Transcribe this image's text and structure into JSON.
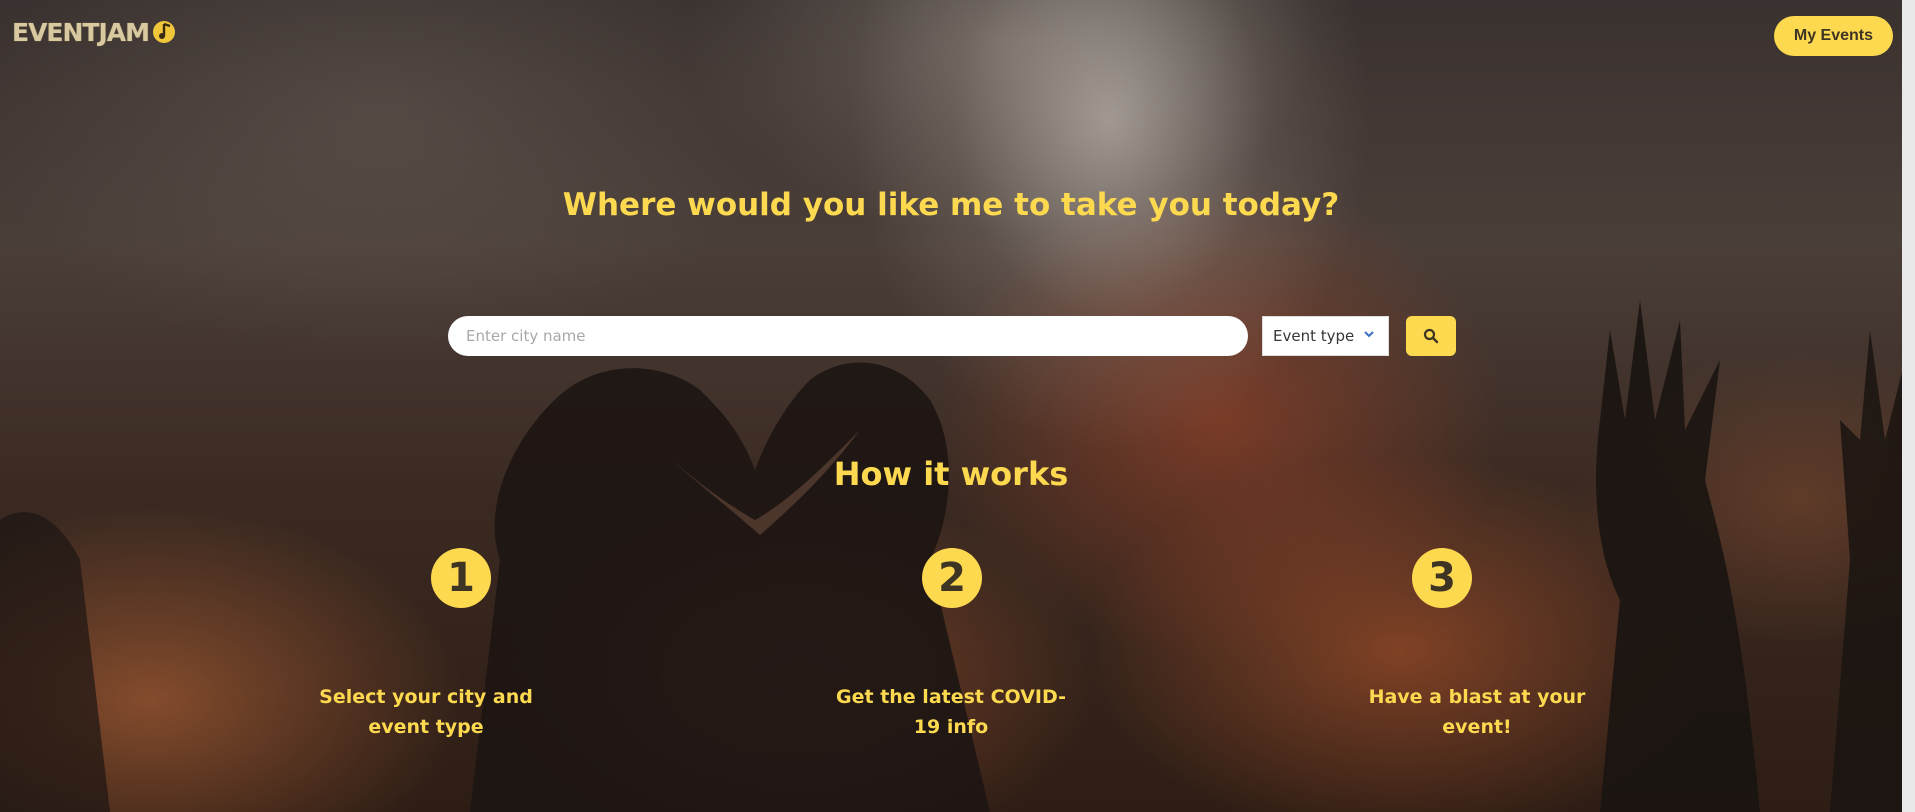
{
  "header": {
    "logo_text": "EVENTJAM",
    "my_events_label": "My Events"
  },
  "hero": {
    "headline": "Where would you like me to take you today?"
  },
  "search": {
    "placeholder": "Enter city name",
    "value": "",
    "event_type_label": "Event type"
  },
  "how_it_works": {
    "title": "How it works",
    "steps": [
      {
        "number": "1",
        "text": "Select your city and event type"
      },
      {
        "number": "2",
        "text": "Get the latest COVID-19 info"
      },
      {
        "number": "3",
        "text": "Have a blast at your event!"
      }
    ]
  },
  "colors": {
    "accent": "#fdd950",
    "button_text": "#3d3424",
    "chevron": "#3b6fc7"
  },
  "icons": {
    "logo_mark": "globe-music-icon",
    "dropdown": "chevron-down-icon",
    "search": "search-icon"
  }
}
